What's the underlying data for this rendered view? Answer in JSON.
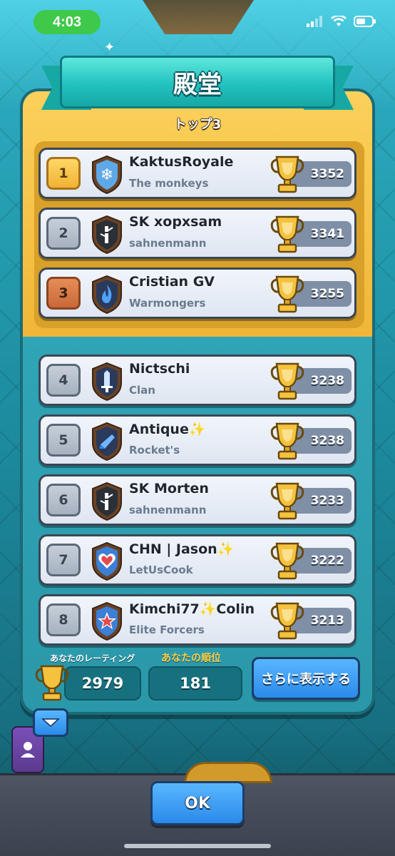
{
  "status_bar": {
    "time": "4:03"
  },
  "header": {
    "title": "殿堂",
    "section_title": "トップ3"
  },
  "players": [
    {
      "rank": "1",
      "name": "KaktusRoyale",
      "clan": "The monkeys",
      "trophies": "3352",
      "rank_style": "gold",
      "badge_color": "#5fa8e8",
      "badge_icon": "snowflake-icon"
    },
    {
      "rank": "2",
      "name": "SK xopxsam",
      "clan": "sahnenmann",
      "trophies": "3341",
      "rank_style": "silver",
      "badge_color": "#2b2f36",
      "badge_icon": "bamboo-icon"
    },
    {
      "rank": "3",
      "name": "Cristian GV",
      "clan": "Warmongers",
      "trophies": "3255",
      "rank_style": "bronze",
      "badge_color": "#2b3a5a",
      "badge_icon": "flame-icon"
    },
    {
      "rank": "4",
      "name": "Nictschi",
      "clan": "Clan",
      "trophies": "3238",
      "rank_style": "silver",
      "badge_color": "#2b3a5a",
      "badge_icon": "sword-icon"
    },
    {
      "rank": "5",
      "name": "Antique✨",
      "clan": "Rocket's",
      "trophies": "3238",
      "rank_style": "silver",
      "badge_color": "#2b3a5a",
      "badge_icon": "rocket-icon"
    },
    {
      "rank": "6",
      "name": "SK Morten",
      "clan": "sahnenmann",
      "trophies": "3233",
      "rank_style": "silver",
      "badge_color": "#2b2f36",
      "badge_icon": "bamboo-icon"
    },
    {
      "rank": "7",
      "name": "CHN | Jason✨",
      "clan": "LetUsCook",
      "trophies": "3222",
      "rank_style": "silver",
      "badge_color": "#3c7fd6",
      "badge_icon": "heart-icon"
    },
    {
      "rank": "8",
      "name": "Kimchi77✨Colin",
      "clan": "Elite Forcers",
      "trophies": "3213",
      "rank_style": "silver",
      "badge_color": "#3c7fd6",
      "badge_icon": "star-icon"
    }
  ],
  "footer": {
    "your_rating_label": "あなたのレーティング",
    "your_rating": "2979",
    "your_rank_label": "あなたの順位",
    "your_rank": "181",
    "more_button": "さらに表示する"
  },
  "ok_button": "OK"
}
